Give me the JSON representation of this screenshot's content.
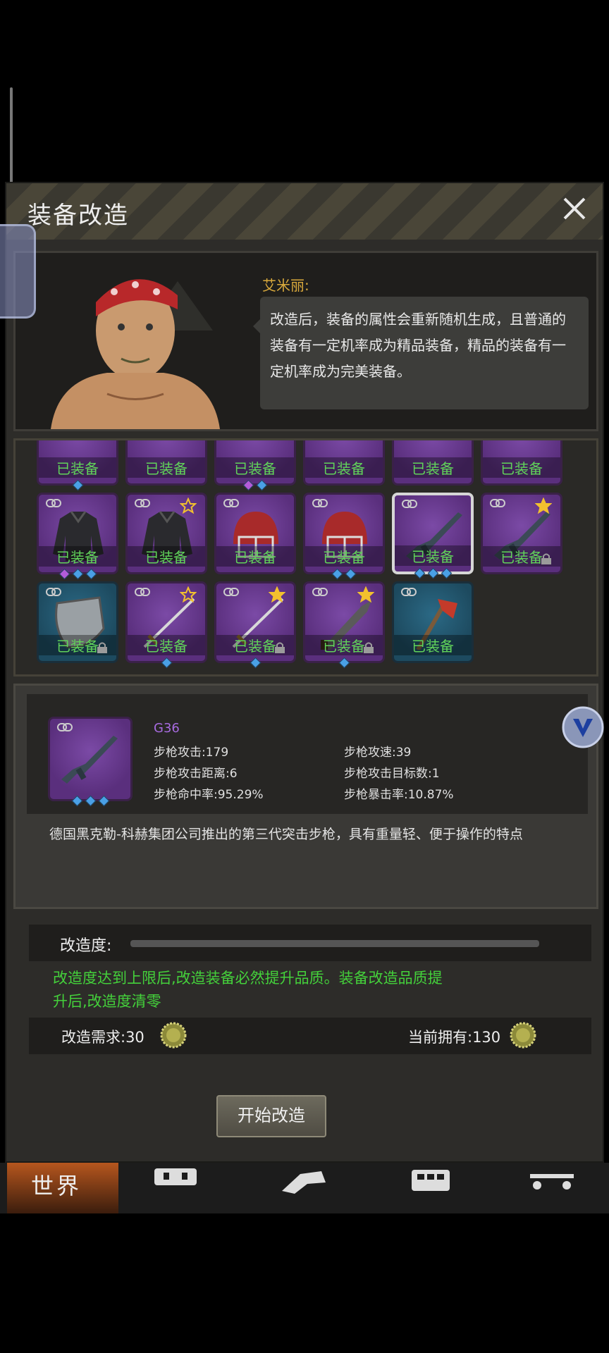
{
  "dialog": {
    "title": "装备改造"
  },
  "npc": {
    "name": "艾米丽:",
    "message": "改造后，装备的属性会重新随机生成，且普通的装备有一定机率成为精品装备，精品的装备有一定机率成为完美装备。"
  },
  "grid": {
    "equipped_label": "已装备",
    "rows": [
      [
        {
          "label": "已装备",
          "gems": [
            "blue"
          ]
        },
        {
          "label": "已装备",
          "gems": []
        },
        {
          "label": "已装备",
          "gems": [
            "purple",
            "blue"
          ]
        },
        {
          "label": "已装备",
          "gems": []
        },
        {
          "label": "已装备",
          "gems": []
        },
        {
          "label": "已装备",
          "gems": []
        }
      ],
      [
        {
          "label": "已装备",
          "item": "jacket-icon",
          "gems": [
            "purple",
            "blue",
            "blue"
          ]
        },
        {
          "label": "已装备",
          "item": "jacket-icon",
          "star": "outline",
          "gems": []
        },
        {
          "label": "已装备",
          "item": "helmet-icon",
          "gems": []
        },
        {
          "label": "已装备",
          "item": "helmet-icon",
          "gems": [
            "blue",
            "blue"
          ]
        },
        {
          "label": "已装备",
          "item": "rifle-icon",
          "selected": true,
          "gems": [
            "blue",
            "blue",
            "blue"
          ]
        },
        {
          "label": "已装备",
          "item": "rifle-icon",
          "star": "gold",
          "lock": true,
          "gems": []
        }
      ],
      [
        {
          "label": "已装备",
          "item": "shield-icon",
          "color": "blue",
          "lock": true,
          "gems": []
        },
        {
          "label": "已装备",
          "item": "sword-icon",
          "star": "outline",
          "gems": [
            "blue"
          ]
        },
        {
          "label": "已装备",
          "item": "sword-icon",
          "star": "gold",
          "lock": true,
          "gems": [
            "blue"
          ]
        },
        {
          "label": "已装备",
          "item": "machete-icon",
          "star": "gold",
          "lock": true,
          "gems": [
            "blue"
          ]
        },
        {
          "label": "已装备",
          "item": "axe-icon",
          "color": "blue",
          "gems": []
        }
      ]
    ]
  },
  "detail": {
    "name": "G36",
    "stats": {
      "attack": "步枪攻击:179",
      "speed": "步枪攻速:39",
      "range": "步枪攻击距离:6",
      "targets": "步枪攻击目标数:1",
      "accuracy": "步枪命中率:95.29%",
      "crit": "步枪暴击率:10.87%"
    },
    "description": "德国黑克勒-科赫集团公司推出的第三代突击步枪，具有重量轻、便于操作的特点"
  },
  "progress": {
    "label": "改造度:",
    "value": 0.0,
    "note": "改造度达到上限后,改造装备必然提升品质。装备改造品质提升后,改造度清零"
  },
  "cost": {
    "required": "改造需求:30",
    "owned": "当前拥有:130"
  },
  "start_button": "开始改造",
  "bottom_nav": {
    "world": "世界"
  },
  "colors": {
    "label_green": "#61d35a",
    "note_green": "#44d13b",
    "npc_name": "#d9a93c",
    "item_name": "#a76be0",
    "slot_purple": "#5a2f7d",
    "slot_blue": "#1d4a5f"
  }
}
